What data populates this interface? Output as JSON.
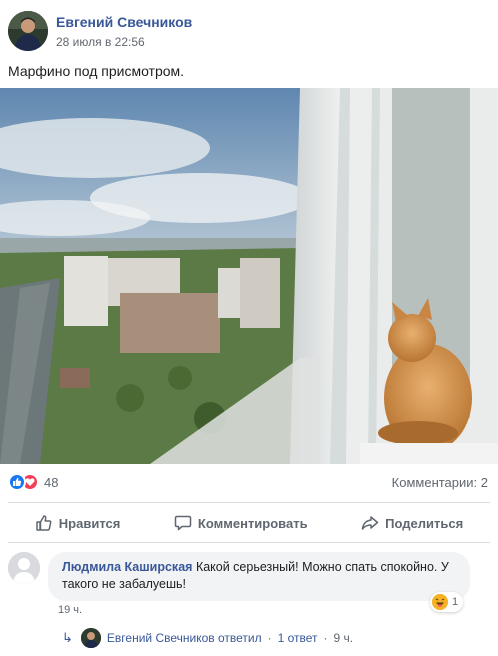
{
  "post": {
    "author": "Евгений Свечников",
    "time": "28 июля в 22:56",
    "text": "Марфино под присмотром."
  },
  "stats": {
    "reactions_count": "48",
    "comments_label": "Комментарии: 2"
  },
  "actions": {
    "like": "Нравится",
    "comment": "Комментировать",
    "share": "Поделиться"
  },
  "comment": {
    "author": "Людмила Каширская",
    "text": "Какой серьезный! Можно спать спокойно. У такого не забалуешь!",
    "time": "19 ч.",
    "reaction_count": "1"
  },
  "reply": {
    "author_replied": "Евгений Свечников ответил",
    "separator": "·",
    "replies_count": "1 ответ",
    "time": "9 ч."
  },
  "colors": {
    "link": "#385898",
    "like_blue": "#1877f2",
    "love_red": "#f33e58"
  }
}
